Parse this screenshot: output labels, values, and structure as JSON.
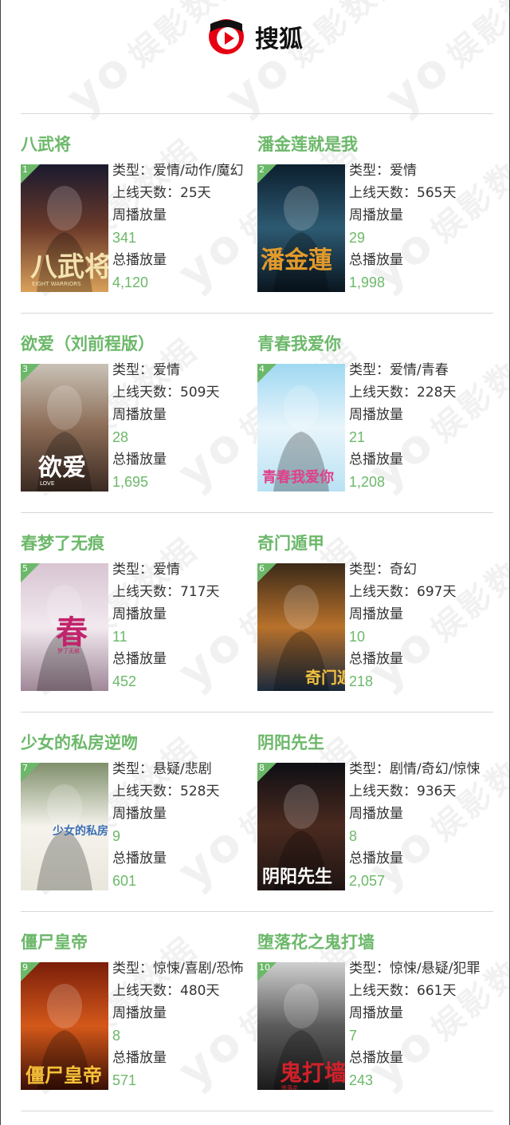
{
  "header": {
    "brand_name": "搜狐",
    "logo_icon": "sohu-logo-icon",
    "brand_color": "#e60012"
  },
  "watermark": {
    "text": "娱影数据",
    "mark": "yo"
  },
  "colors": {
    "accent": "#6cb86a",
    "text": "#333333",
    "divider": "#d8d8d8"
  },
  "labels": {
    "type_prefix": "类型：",
    "days_prefix": "上线天数：",
    "days_suffix": "天",
    "weekly": "周播放量",
    "total": "总播放量"
  },
  "shows": [
    {
      "rank": "1",
      "title": "八武将",
      "type": "类型：爱情/动作/魔幻",
      "days": "上线天数：25天",
      "weekly_label": "周播放量",
      "weekly": "341",
      "total_label": "总播放量",
      "total": "4,120",
      "poster_text": "八武将",
      "poster_sub": "EIGHT WARRIORS"
    },
    {
      "rank": "2",
      "title": "潘金莲就是我",
      "type": "类型：爱情",
      "days": "上线天数：565天",
      "weekly_label": "周播放量",
      "weekly": "29",
      "total_label": "总播放量",
      "total": "1,998",
      "poster_text": "潘金蓮",
      "poster_sub": ""
    },
    {
      "rank": "3",
      "title": "欲爱（刘前程版）",
      "type": "类型：爱情",
      "days": "上线天数：509天",
      "weekly_label": "周播放量",
      "weekly": "28",
      "total_label": "总播放量",
      "total": "1,695",
      "poster_text": "欲爱",
      "poster_sub": "LOVE"
    },
    {
      "rank": "4",
      "title": "青春我爱你",
      "type": "类型：爱情/青春",
      "days": "上线天数：228天",
      "weekly_label": "周播放量",
      "weekly": "21",
      "total_label": "总播放量",
      "total": "1,208",
      "poster_text": "青春我爱你",
      "poster_sub": ""
    },
    {
      "rank": "5",
      "title": "春梦了无痕",
      "type": "类型：爱情",
      "days": "上线天数：717天",
      "weekly_label": "周播放量",
      "weekly": "11",
      "total_label": "总播放量",
      "total": "452",
      "poster_text": "春",
      "poster_sub": "梦了无痕"
    },
    {
      "rank": "6",
      "title": "奇门遁甲",
      "type": "类型：奇幻",
      "days": "上线天数：697天",
      "weekly_label": "周播放量",
      "weekly": "10",
      "total_label": "总播放量",
      "total": "218",
      "poster_text": "奇门遁甲",
      "poster_sub": ""
    },
    {
      "rank": "7",
      "title": "少女的私房逆吻",
      "type": "类型：悬疑/悲剧",
      "days": "上线天数：528天",
      "weekly_label": "周播放量",
      "weekly": "9",
      "total_label": "总播放量",
      "total": "601",
      "poster_text": "少女的私房逆吻",
      "poster_sub": ""
    },
    {
      "rank": "8",
      "title": "阴阳先生",
      "type": "类型：剧情/奇幻/惊悚",
      "days": "上线天数：936天",
      "weekly_label": "周播放量",
      "weekly": "8",
      "total_label": "总播放量",
      "total": "2,057",
      "poster_text": "阴阳先生",
      "poster_sub": ""
    },
    {
      "rank": "9",
      "title": "僵尸皇帝",
      "type": "类型：惊悚/喜剧/恐怖",
      "days": "上线天数：480天",
      "weekly_label": "周播放量",
      "weekly": "8",
      "total_label": "总播放量",
      "total": "571",
      "poster_text": "僵尸皇帝",
      "poster_sub": ""
    },
    {
      "rank": "10",
      "title": "堕落花之鬼打墙",
      "type": "类型：惊悚/悬疑/犯罪",
      "days": "上线天数：661天",
      "weekly_label": "周播放量",
      "weekly": "7",
      "total_label": "总播放量",
      "total": "243",
      "poster_text": "鬼打墙",
      "poster_sub": "堕落花"
    }
  ]
}
